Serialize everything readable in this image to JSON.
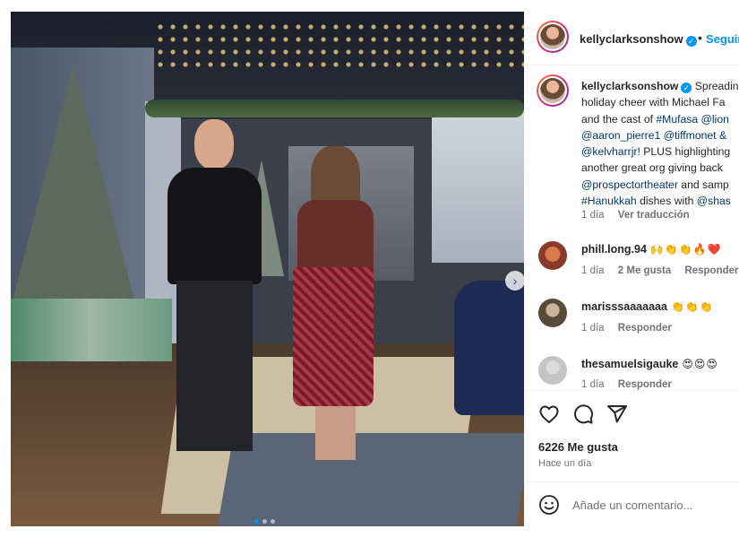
{
  "post": {
    "carousel_next_icon": "chevron-right-icon",
    "carousel_next_glyph": "›",
    "carousel_dots": 3,
    "carousel_active_index": 0
  },
  "header": {
    "username": "kellyclarksonshow",
    "separator": "•",
    "follow_label": "Seguir"
  },
  "caption": {
    "username": "kellyclarksonshow",
    "lines": [
      "Spreadin",
      "holiday cheer with Michael Fa",
      "and the cast of #Mufasa @lion",
      "@aaron_pierre1 @tiffmonet &",
      "@kelvharrjr! PLUS highlighting",
      "another great org giving back",
      "@prospectortheater and samp",
      "#Hanukkah dishes with @shas"
    ],
    "age": "1 día",
    "translate_label": "Ver traducción"
  },
  "comments": [
    {
      "username": "phill.long.94",
      "emoji": "🙌👏👏🔥❤️",
      "age": "1 día",
      "likes": "2 Me gusta",
      "reply": "Responder"
    },
    {
      "username": "marisssaaaaaaa",
      "emoji": "👏👏👏",
      "age": "1 día",
      "likes": "",
      "reply": "Responder"
    },
    {
      "username": "thesamuelsigauke",
      "emoji": "😍😍😍",
      "age": "1 día",
      "likes": "",
      "reply": "Responder"
    }
  ],
  "actions": {
    "like_icon": "heart-icon",
    "comment_icon": "comment-icon",
    "share_icon": "share-icon",
    "likes_count": "6226 Me gusta",
    "posted": "Hace un día"
  },
  "add_comment": {
    "emoji_icon": "smiley-icon",
    "placeholder": "Añade un comentario..."
  },
  "colors": {
    "accent": "#0095f6",
    "link": "#00376b",
    "muted": "#737373"
  }
}
